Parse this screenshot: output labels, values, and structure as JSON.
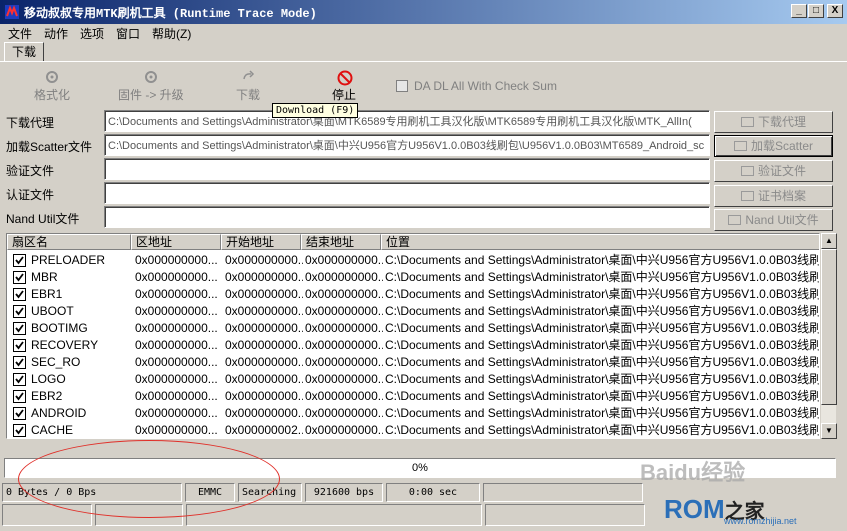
{
  "window": {
    "title": "移动叔叔专用MTK刷机工具 (Runtime Trace Mode)",
    "buttons": [
      "_",
      "□",
      "X"
    ]
  },
  "menu": [
    "文件",
    "动作",
    "选项",
    "窗口",
    "帮助(Z)"
  ],
  "tabs": [
    "下载"
  ],
  "toolbar": {
    "format": "格式化",
    "firmware_upgrade": "固件 -> 升级",
    "download": "下载",
    "stop": "停止",
    "checkbox_label": "DA DL All With Check Sum"
  },
  "tooltip": "Download (F9)",
  "fields": [
    {
      "label": "下载代理",
      "value": "C:\\Documents and Settings\\Administrator\\桌面\\MTK6589专用刷机工具汉化版\\MTK6589专用刷机工具汉化版\\MTK_AllIn(",
      "button": "下载代理"
    },
    {
      "label": "加载Scatter文件",
      "value": "C:\\Documents and Settings\\Administrator\\桌面\\中兴U956官方U956V1.0.0B03线刷包\\U956V1.0.0B03\\MT6589_Android_sc",
      "button": "加载Scatter"
    },
    {
      "label": "验证文件",
      "value": "",
      "button": "验证文件"
    },
    {
      "label": "认证文件",
      "value": "",
      "button": "证书档案"
    },
    {
      "label": "Nand Util文件",
      "value": "",
      "button": "Nand Util文件"
    }
  ],
  "table": {
    "columns": [
      "扇区名",
      "区地址",
      "开始地址",
      "结束地址",
      "位置"
    ],
    "rows": [
      {
        "name": "PRELOADER",
        "region": "0x000000000...",
        "start": "0x000000000...",
        "end": "0x000000000...",
        "location": "C:\\Documents and Settings\\Administrator\\桌面\\中兴U956官方U956V1.0.0B03线刷包\\U9"
      },
      {
        "name": "MBR",
        "region": "0x000000000...",
        "start": "0x000000000...",
        "end": "0x000000000...",
        "location": "C:\\Documents and Settings\\Administrator\\桌面\\中兴U956官方U956V1.0.0B03线刷包\\U9"
      },
      {
        "name": "EBR1",
        "region": "0x000000000...",
        "start": "0x000000000...",
        "end": "0x000000000...",
        "location": "C:\\Documents and Settings\\Administrator\\桌面\\中兴U956官方U956V1.0.0B03线刷包\\U9"
      },
      {
        "name": "UBOOT",
        "region": "0x000000000...",
        "start": "0x000000000...",
        "end": "0x000000000...",
        "location": "C:\\Documents and Settings\\Administrator\\桌面\\中兴U956官方U956V1.0.0B03线刷包\\U9"
      },
      {
        "name": "BOOTIMG",
        "region": "0x000000000...",
        "start": "0x000000000...",
        "end": "0x000000000...",
        "location": "C:\\Documents and Settings\\Administrator\\桌面\\中兴U956官方U956V1.0.0B03线刷包\\U9"
      },
      {
        "name": "RECOVERY",
        "region": "0x000000000...",
        "start": "0x000000000...",
        "end": "0x000000000...",
        "location": "C:\\Documents and Settings\\Administrator\\桌面\\中兴U956官方U956V1.0.0B03线刷包\\U9"
      },
      {
        "name": "SEC_RO",
        "region": "0x000000000...",
        "start": "0x000000000...",
        "end": "0x000000000...",
        "location": "C:\\Documents and Settings\\Administrator\\桌面\\中兴U956官方U956V1.0.0B03线刷包\\U9"
      },
      {
        "name": "LOGO",
        "region": "0x000000000...",
        "start": "0x000000000...",
        "end": "0x000000000...",
        "location": "C:\\Documents and Settings\\Administrator\\桌面\\中兴U956官方U956V1.0.0B03线刷包\\U9"
      },
      {
        "name": "EBR2",
        "region": "0x000000000...",
        "start": "0x000000000...",
        "end": "0x000000000...",
        "location": "C:\\Documents and Settings\\Administrator\\桌面\\中兴U956官方U956V1.0.0B03线刷包\\U9"
      },
      {
        "name": "ANDROID",
        "region": "0x000000000...",
        "start": "0x000000000...",
        "end": "0x000000000...",
        "location": "C:\\Documents and Settings\\Administrator\\桌面\\中兴U956官方U956V1.0.0B03线刷包\\U9"
      },
      {
        "name": "CACHE",
        "region": "0x000000000...",
        "start": "0x000000002...",
        "end": "0x000000000...",
        "location": "C:\\Documents and Settings\\Administrator\\桌面\\中兴U956官方U956V1.0.0B03线刷包\\U9"
      }
    ]
  },
  "progress": {
    "text": "0%",
    "value": 0
  },
  "status": {
    "bytes": "0 Bytes / 0 Bps",
    "storage": "EMMC",
    "state": "Searching",
    "baud": "921600 bps",
    "time": "0:00 sec"
  },
  "watermarks": {
    "baidu": "Baidu经验",
    "rom_brand": "ROM",
    "rom_zh": "之家",
    "rom_url": "www.romzhijia.net"
  },
  "colors": {
    "titlebar_start": "#0a246a",
    "titlebar_end": "#a6caf0",
    "face": "#d4d0c8",
    "stop_red": "#e01010",
    "annotation_red": "#e0302a"
  }
}
